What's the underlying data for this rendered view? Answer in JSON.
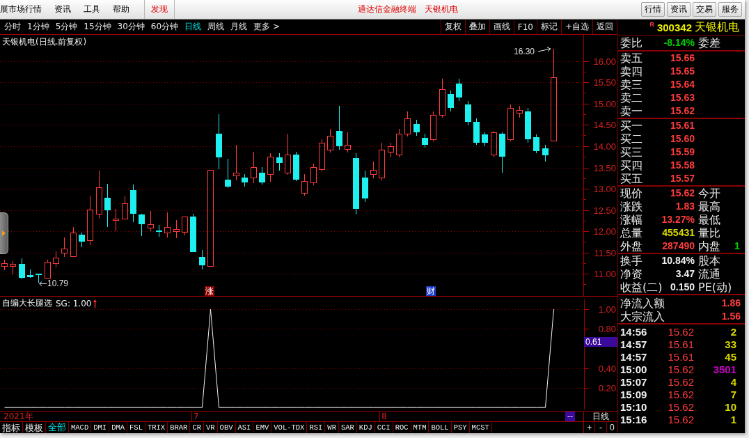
{
  "menu_bar": {
    "menu_items": [
      "展市场行情",
      "资讯",
      "工具",
      "帮助"
    ],
    "discover": "发现",
    "app_title": "通达信金融终端",
    "stock_title": "天银机电",
    "buttons": [
      "行情",
      "资讯",
      "交易",
      "服务"
    ]
  },
  "period_tabs": [
    {
      "label": "分时",
      "selected": false
    },
    {
      "label": "1分钟",
      "selected": false
    },
    {
      "label": "5分钟",
      "selected": false
    },
    {
      "label": "15分钟",
      "selected": false
    },
    {
      "label": "30分钟",
      "selected": false
    },
    {
      "label": "60分钟",
      "selected": false
    },
    {
      "label": "日线",
      "selected": true
    },
    {
      "label": "周线",
      "selected": false
    },
    {
      "label": "月线",
      "selected": false
    },
    {
      "label": "更多 >",
      "selected": false
    }
  ],
  "chart_toolbar": [
    "复权",
    "叠加",
    "画线",
    "F10",
    "标记",
    "+自选",
    "返回"
  ],
  "price_chart": {
    "title": "天银机电(日线.前复权)",
    "high_label": "16.30",
    "low_label": "10.79",
    "event_markers": [
      {
        "label": "涨",
        "color": "#8b0000"
      },
      {
        "label": "财",
        "color": "#1a3cc8"
      }
    ],
    "chart_data": {
      "type": "candlestick",
      "categories": [
        null,
        null,
        null,
        null,
        null,
        null,
        null,
        null,
        null,
        null,
        null,
        null,
        null,
        null,
        null,
        null,
        null,
        null,
        null,
        null,
        null,
        null,
        null,
        null,
        null,
        null,
        null,
        null,
        null,
        null,
        null,
        null,
        null,
        null,
        null,
        null,
        null,
        null,
        null,
        null,
        null,
        null,
        null,
        null,
        null,
        null,
        null,
        null,
        null,
        null,
        null,
        null,
        null,
        null,
        null,
        null,
        null,
        null,
        null,
        null,
        null,
        null,
        null,
        null,
        null,
        null,
        null,
        null
      ],
      "ohlc": [
        [
          11.18,
          11.33,
          11.1,
          11.25
        ],
        [
          11.18,
          11.3,
          11.0,
          11.23
        ],
        [
          11.23,
          11.36,
          10.87,
          10.9
        ],
        [
          10.97,
          11.11,
          10.9,
          10.92
        ],
        [
          11.0,
          11.0,
          10.79,
          10.97
        ],
        [
          10.9,
          11.33,
          10.9,
          11.28
        ],
        [
          11.25,
          11.52,
          11.16,
          11.38
        ],
        [
          11.49,
          11.85,
          11.41,
          11.59
        ],
        [
          11.41,
          12.1,
          11.41,
          11.97
        ],
        [
          11.92,
          11.97,
          11.62,
          11.75
        ],
        [
          11.79,
          12.84,
          11.69,
          12.51
        ],
        [
          12.41,
          13.43,
          12.31,
          13.03
        ],
        [
          12.79,
          13.11,
          12.1,
          12.49
        ],
        [
          12.26,
          12.52,
          12.02,
          12.3
        ],
        [
          12.3,
          12.82,
          12.3,
          12.66
        ],
        [
          12.97,
          13.1,
          12.21,
          12.41
        ],
        [
          12.39,
          12.41,
          11.89,
          12.16
        ],
        [
          12.08,
          12.48,
          12.02,
          12.16
        ],
        [
          12.02,
          12.15,
          11.87,
          11.98
        ],
        [
          11.97,
          12.44,
          11.87,
          12.1
        ],
        [
          12.0,
          12.26,
          11.85,
          12.05
        ],
        [
          11.98,
          12.34,
          11.92,
          12.34
        ],
        [
          12.34,
          12.41,
          11.51,
          11.51
        ],
        [
          11.39,
          11.56,
          11.1,
          11.2
        ],
        [
          11.18,
          13.44,
          11.18,
          13.44
        ],
        [
          14.3,
          14.75,
          13.46,
          13.74
        ],
        [
          13.21,
          13.7,
          13.02,
          13.05
        ],
        [
          13.31,
          14.03,
          13.21,
          13.38
        ],
        [
          13.26,
          13.34,
          13.05,
          13.15
        ],
        [
          13.26,
          13.87,
          13.15,
          13.51
        ],
        [
          13.38,
          13.51,
          13.1,
          13.15
        ],
        [
          13.34,
          13.84,
          13.18,
          13.75
        ],
        [
          13.74,
          13.84,
          13.43,
          13.61
        ],
        [
          13.38,
          14.3,
          13.34,
          13.8
        ],
        [
          13.8,
          13.87,
          13.18,
          13.21
        ],
        [
          12.9,
          13.34,
          12.85,
          13.18
        ],
        [
          13.15,
          13.59,
          13.1,
          13.51
        ],
        [
          13.46,
          14.16,
          13.43,
          14.08
        ],
        [
          13.92,
          14.41,
          13.87,
          14.25
        ],
        [
          14.36,
          14.95,
          13.92,
          14.0
        ],
        [
          13.93,
          14.33,
          13.87,
          14.03
        ],
        [
          13.72,
          13.84,
          12.39,
          12.52
        ],
        [
          13.26,
          13.43,
          12.69,
          12.77
        ],
        [
          13.34,
          13.64,
          13.26,
          13.44
        ],
        [
          13.26,
          14.08,
          13.21,
          13.92
        ],
        [
          13.87,
          14.08,
          13.75,
          14.0
        ],
        [
          13.8,
          14.41,
          13.75,
          14.3
        ],
        [
          14.3,
          14.82,
          14.25,
          14.66
        ],
        [
          14.52,
          14.62,
          14.25,
          14.33
        ],
        [
          14.2,
          14.3,
          13.97,
          14.03
        ],
        [
          14.16,
          14.82,
          14.13,
          14.74
        ],
        [
          14.74,
          15.59,
          14.69,
          15.34
        ],
        [
          15.23,
          15.31,
          14.82,
          14.9
        ],
        [
          15.48,
          15.59,
          15.07,
          15.15
        ],
        [
          14.98,
          15.07,
          14.49,
          14.57
        ],
        [
          14.57,
          14.66,
          14.03,
          14.08
        ],
        [
          14.28,
          14.33,
          14.0,
          14.08
        ],
        [
          13.8,
          14.36,
          13.75,
          14.33
        ],
        [
          14.3,
          14.33,
          13.38,
          13.75
        ],
        [
          14.16,
          14.98,
          14.13,
          14.9
        ],
        [
          14.79,
          14.95,
          14.69,
          14.85
        ],
        [
          14.82,
          14.9,
          14.08,
          14.16
        ],
        [
          14.21,
          14.28,
          13.84,
          13.89
        ],
        [
          13.95,
          14.03,
          13.64,
          13.79
        ],
        [
          14.13,
          16.3,
          14.13,
          15.62
        ],
        null,
        null,
        null
      ],
      "ylim": [
        10.48,
        16.62
      ],
      "grid": true,
      "yticks": [
        {
          "value": 16,
          "label": "16.00"
        },
        {
          "value": 15.5,
          "label": "15.50"
        },
        {
          "value": 15,
          "label": "15.00"
        },
        {
          "value": 14.5,
          "label": "14.50"
        },
        {
          "value": 14,
          "label": "14.00"
        },
        {
          "value": 13.5,
          "label": "13.50"
        },
        {
          "value": 13,
          "label": "13.00"
        },
        {
          "value": 12.5,
          "label": "12.50"
        },
        {
          "value": 12,
          "label": "12.00"
        },
        {
          "value": 11.5,
          "label": "11.50"
        },
        {
          "value": 11,
          "label": "11.00"
        }
      ]
    }
  },
  "indicator": {
    "legend": "SG: 1.00",
    "cursor_value": "0.61",
    "chart_data": {
      "type": "line",
      "title": "自编大长腿选",
      "values": [
        0,
        0,
        0,
        0,
        0,
        0,
        0,
        0,
        0,
        0,
        0,
        0,
        0,
        0,
        0,
        0,
        0,
        0,
        0,
        0,
        0,
        0,
        0,
        0,
        1,
        0,
        0,
        0,
        0,
        0,
        0,
        0,
        0,
        0,
        0,
        0,
        0,
        0,
        0,
        0,
        0,
        0,
        0,
        0,
        0,
        0,
        0,
        0,
        0,
        0,
        0,
        0,
        0,
        0,
        0,
        0,
        0,
        0,
        0,
        0,
        0,
        0,
        0,
        0,
        1,
        null,
        null,
        null
      ],
      "ylim": [
        -0.02,
        1.1
      ],
      "grid": true,
      "yticks": [
        {
          "value": 1,
          "label": "1.00"
        },
        {
          "value": 0.8,
          "label": "0.80"
        },
        {
          "value": 0.4,
          "label": "0.40"
        },
        {
          "value": 0.2,
          "label": "0.20"
        }
      ]
    }
  },
  "time_axis": {
    "labels": [
      "2021年",
      "7",
      "8"
    ],
    "cursor_date": "--",
    "period": "日线"
  },
  "indicator_bar": {
    "buttons": [
      "指标",
      "模板"
    ],
    "tabs": [
      {
        "kind": "category",
        "label": "全部",
        "selected": true
      },
      {
        "kind": "indicator",
        "label": "MACD",
        "selected": false
      },
      {
        "kind": "indicator",
        "label": "DMI",
        "selected": false
      },
      {
        "kind": "indicator",
        "label": "DMA",
        "selected": false
      },
      {
        "kind": "indicator",
        "label": "FSL",
        "selected": false
      },
      {
        "kind": "indicator",
        "label": "TRIX",
        "selected": false
      },
      {
        "kind": "indicator",
        "label": "BRAR",
        "selected": false
      },
      {
        "kind": "indicator",
        "label": "CR",
        "selected": false
      },
      {
        "kind": "indicator",
        "label": "VR",
        "selected": false
      },
      {
        "kind": "indicator",
        "label": "OBV",
        "selected": false
      },
      {
        "kind": "indicator",
        "label": "ASI",
        "selected": false
      },
      {
        "kind": "indicator",
        "label": "EMV",
        "selected": false
      },
      {
        "kind": "indicator",
        "label": "VOL-TDX",
        "selected": false
      },
      {
        "kind": "indicator",
        "label": "RSI",
        "selected": false
      },
      {
        "kind": "indicator",
        "label": "WR",
        "selected": false
      },
      {
        "kind": "indicator",
        "label": "SAR",
        "selected": false
      },
      {
        "kind": "indicator",
        "label": "KDJ",
        "selected": false
      },
      {
        "kind": "indicator",
        "label": "CCI",
        "selected": false
      },
      {
        "kind": "indicator",
        "label": "ROC",
        "selected": false
      },
      {
        "kind": "indicator",
        "label": "MTM",
        "selected": false
      },
      {
        "kind": "indicator",
        "label": "BOLL",
        "selected": false
      },
      {
        "kind": "indicator",
        "label": "PSY",
        "selected": false
      },
      {
        "kind": "indicator",
        "label": "MCST",
        "selected": false
      }
    ],
    "zoom_controls": [
      "+",
      "-",
      "0"
    ]
  },
  "quote": {
    "flag": "R",
    "code": "300342",
    "name": "天银机电",
    "ratio": {
      "label": "委比",
      "value": "-8.14%",
      "label2": "委差"
    },
    "asks": [
      {
        "label": "卖五",
        "price": "15.66"
      },
      {
        "label": "卖四",
        "price": "15.65"
      },
      {
        "label": "卖三",
        "price": "15.64"
      },
      {
        "label": "卖二",
        "price": "15.63"
      },
      {
        "label": "卖一",
        "price": "15.62"
      }
    ],
    "bids": [
      {
        "label": "买一",
        "price": "15.61"
      },
      {
        "label": "买二",
        "price": "15.60"
      },
      {
        "label": "买三",
        "price": "15.59"
      },
      {
        "label": "买四",
        "price": "15.58"
      },
      {
        "label": "买五",
        "price": "15.57"
      }
    ],
    "stats": [
      {
        "label": "现价",
        "value": "15.62",
        "color": "#ff3c3c",
        "label2": "今开"
      },
      {
        "label": "涨跌",
        "value": "1.83",
        "color": "#ff3c3c",
        "label2": "最高"
      },
      {
        "label": "涨幅",
        "value": "13.27%",
        "color": "#ff3c3c",
        "label2": "最低"
      },
      {
        "label": "总量",
        "value": "455431",
        "color": "#d8d800",
        "label2": "量比"
      },
      {
        "label": "外盘",
        "value": "287490",
        "color": "#ff3c3c",
        "label2": "内盘",
        "extra": {
          "value": "1",
          "color": "#00d000"
        }
      }
    ],
    "fundamentals": [
      {
        "label": "换手",
        "value": "10.84%",
        "label2": "股本"
      },
      {
        "label": "净资",
        "value": "3.47",
        "label2": "流通"
      },
      {
        "label": "收益(二)",
        "value": "0.150",
        "label2": "PE(动)"
      }
    ],
    "fund_flow": [
      {
        "label": "净流入额",
        "value": "1.86"
      },
      {
        "label": "大宗流入",
        "value": "1.56"
      }
    ],
    "trades": [
      {
        "time": "14:56",
        "price": "15.62",
        "volume": "2",
        "color": "#d8d800"
      },
      {
        "time": "14:57",
        "price": "15.61",
        "volume": "33",
        "color": "#d8d800"
      },
      {
        "time": "14:57",
        "price": "15.61",
        "volume": "45",
        "color": "#d8d800"
      },
      {
        "time": "15:00",
        "price": "15.62",
        "volume": "3501",
        "color": "#c800c8"
      },
      {
        "time": "15:07",
        "price": "15.62",
        "volume": "4",
        "color": "#d8d800"
      },
      {
        "time": "15:09",
        "price": "15.62",
        "volume": "7",
        "color": "#d8d800"
      },
      {
        "time": "15:10",
        "price": "15.62",
        "volume": "10",
        "color": "#d8d800"
      },
      {
        "time": "15:16",
        "price": "15.62",
        "volume": "1",
        "color": "#d8d800"
      }
    ]
  }
}
